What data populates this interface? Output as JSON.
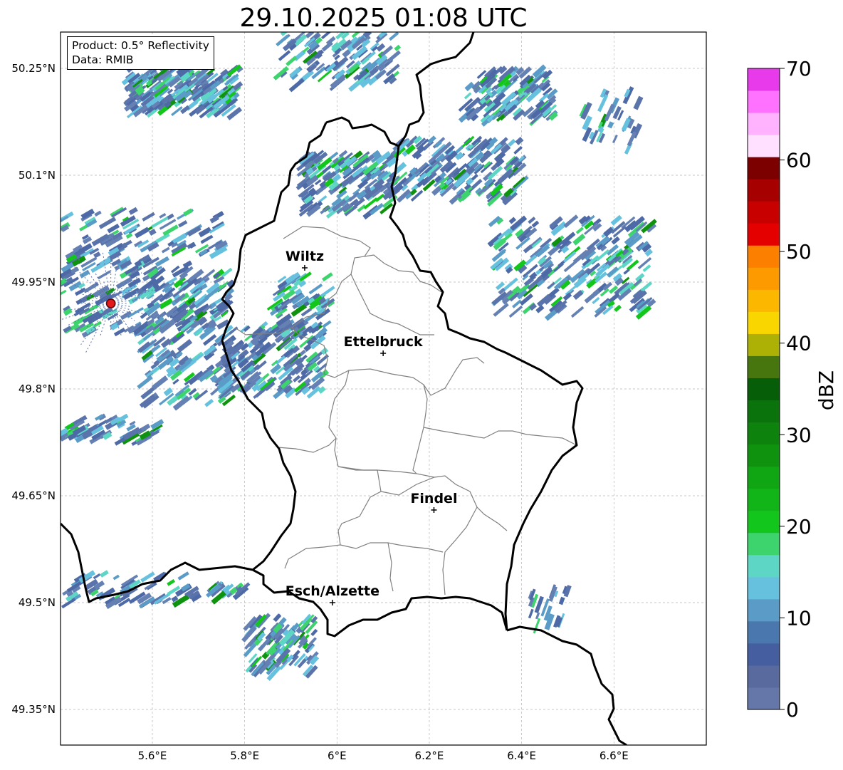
{
  "title": "29.10.2025 01:08 UTC",
  "info_box": {
    "product": "Product: 0.5° Reflectivity",
    "data": "Data: RMIB"
  },
  "axes": {
    "lon_ticks": [
      "5.6°E",
      "5.8°E",
      "6°E",
      "6.2°E",
      "6.4°E",
      "6.6°E"
    ],
    "lat_ticks": [
      "50.25°N",
      "50.1°N",
      "49.95°N",
      "49.8°N",
      "49.65°N",
      "49.5°N",
      "49.35°N"
    ],
    "lon_range": [
      5.4,
      6.8
    ],
    "lat_range": [
      49.3,
      50.3
    ],
    "grid": true
  },
  "places": [
    {
      "name": "Wiltz",
      "lon": 5.93,
      "lat": 49.97
    },
    {
      "name": "Ettelbruck",
      "lon": 6.1,
      "lat": 49.85
    },
    {
      "name": "Findel",
      "lon": 6.21,
      "lat": 49.63
    },
    {
      "name": "Esch/Alzette",
      "lon": 5.99,
      "lat": 49.5
    }
  ],
  "radar_site": {
    "lon": 5.51,
    "lat": 49.92,
    "color": "#e31a1c"
  },
  "colorbar": {
    "label": "dBZ",
    "ticks": [
      "0",
      "10",
      "20",
      "30",
      "40",
      "50",
      "60",
      "70"
    ],
    "min": 0,
    "max": 70,
    "colors": [
      "#6577a8",
      "#586a9e",
      "#445ea0",
      "#4a78ae",
      "#5a9cc7",
      "#66c1df",
      "#5dd6c6",
      "#3dd46e",
      "#13c61c",
      "#11b517",
      "#10a513",
      "#0f930f",
      "#0d830d",
      "#0a730b",
      "#075e08",
      "#46760d",
      "#adb005",
      "#fad600",
      "#fcb700",
      "#fc9a00",
      "#fc7f00",
      "#e50000",
      "#c90000",
      "#a60000",
      "#7d0000",
      "#ffe0ff",
      "#ffb3ff",
      "#ff72ff",
      "#e83aeb"
    ]
  }
}
